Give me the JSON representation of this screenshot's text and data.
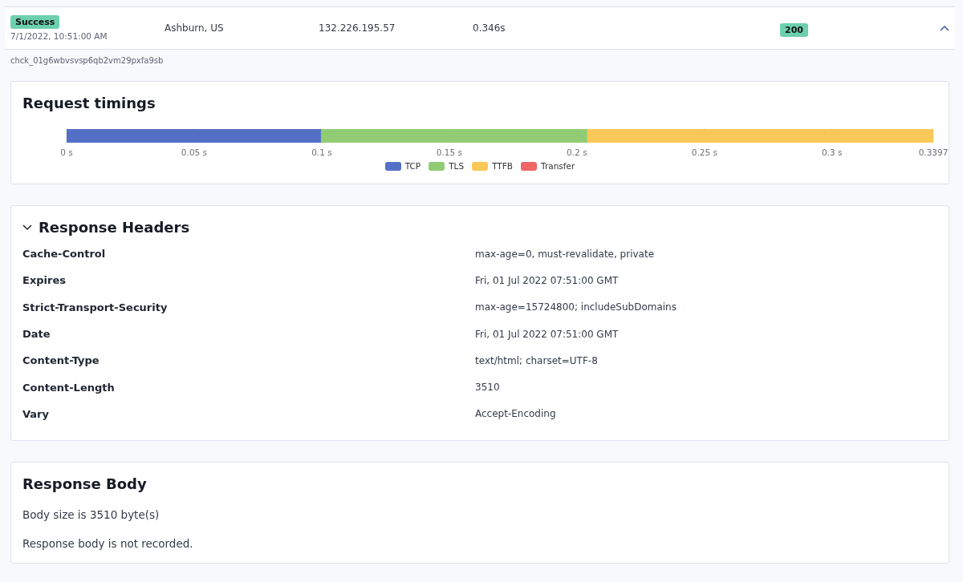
{
  "check_row": {
    "status": "Success",
    "time": "7/1/2022, 10:51:00 AM",
    "location": "Ashburn, US",
    "ip": "132.226.195.57",
    "duration": "0.346s",
    "code": "200",
    "expanded": true
  },
  "check_id": "chck_01g6wbvsvsp6qb2vm29pxfa9sb",
  "timings": {
    "title": "Request timings",
    "chart_data": {
      "type": "bar",
      "orientation": "horizontal",
      "stacked": true,
      "grid": true,
      "legend": "bottom",
      "series": [
        {
          "name": "TCP",
          "color": "#5470c6",
          "values": [
            0.0997
          ]
        },
        {
          "name": "TLS",
          "color": "#91cc75",
          "values": [
            0.1044
          ]
        },
        {
          "name": "TTFB",
          "color": "#fac858",
          "values": [
            0.1356
          ]
        },
        {
          "name": "Transfer",
          "color": "#ee6666",
          "values": [
            0
          ]
        }
      ],
      "xlim": [
        0,
        0.3397
      ],
      "xticks": [
        {
          "value": 0,
          "label": "0 s"
        },
        {
          "value": 0.05,
          "label": "0.05 s"
        },
        {
          "value": 0.1,
          "label": "0.1 s"
        },
        {
          "value": 0.15,
          "label": "0.15 s"
        },
        {
          "value": 0.2,
          "label": "0.2 s"
        },
        {
          "value": 0.25,
          "label": "0.25 s"
        },
        {
          "value": 0.3,
          "label": "0.3 s"
        },
        {
          "value": 0.3397,
          "label": "0.3397"
        }
      ]
    }
  },
  "headers": {
    "title": "Response Headers",
    "expanded": true,
    "rows": [
      {
        "name": "Cache-Control",
        "value": "max-age=0, must-revalidate, private"
      },
      {
        "name": "Expires",
        "value": "Fri, 01 Jul 2022 07:51:00 GMT"
      },
      {
        "name": "Strict-Transport-Security",
        "value": "max-age=15724800; includeSubDomains"
      },
      {
        "name": "Date",
        "value": "Fri, 01 Jul 2022 07:51:00 GMT"
      },
      {
        "name": "Content-Type",
        "value": "text/html; charset=UTF-8"
      },
      {
        "name": "Content-Length",
        "value": "3510"
      },
      {
        "name": "Vary",
        "value": "Accept-Encoding"
      }
    ]
  },
  "body": {
    "title": "Response Body",
    "lines": [
      "Body size is 3510 byte(s)",
      "Response body is not recorded."
    ]
  }
}
